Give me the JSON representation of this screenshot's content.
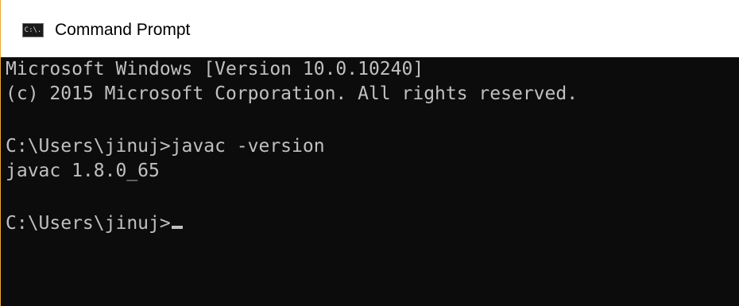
{
  "window": {
    "title": "Command Prompt",
    "icon_name": "cmd-icon",
    "icon_text": "C:\\.",
    "accent_color": "#f0a830",
    "console_background": "#0c0c0c",
    "console_text_color": "#c0c0c0"
  },
  "console": {
    "lines": [
      "Microsoft Windows [Version 10.0.10240]",
      "(c) 2015 Microsoft Corporation. All rights reserved.",
      "C:\\Users\\jinuj>javac -version",
      "javac 1.8.0_65",
      "C:\\Users\\jinuj>"
    ]
  }
}
